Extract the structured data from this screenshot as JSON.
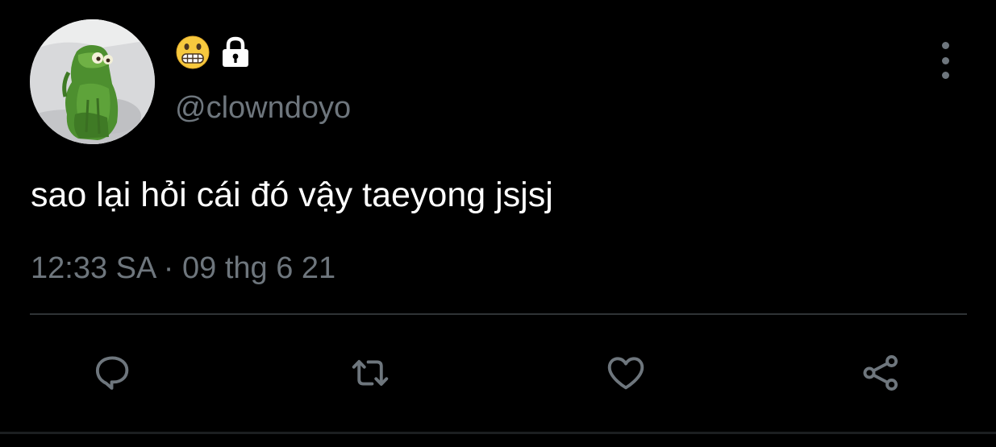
{
  "tweet": {
    "author": {
      "name_icons": [
        "grimacing-face-emoji",
        "lock-icon"
      ],
      "handle": "@clowndoyo",
      "avatar_icon": "kermit-frog-avatar"
    },
    "text": "sao lại hỏi cái đó vậy taeyong jsjsj",
    "timestamp": "12:33 SA · 09 thg 6 21",
    "more_menu_icon": "vertical-ellipsis-icon",
    "actions": [
      {
        "name": "reply",
        "icon": "speech-bubble-icon"
      },
      {
        "name": "retweet",
        "icon": "retweet-arrows-icon"
      },
      {
        "name": "like",
        "icon": "heart-icon"
      },
      {
        "name": "share",
        "icon": "share-nodes-icon"
      }
    ]
  },
  "colors": {
    "background": "#000000",
    "text_primary": "#ffffff",
    "text_secondary": "#6e767d",
    "divider": "#2f3336"
  }
}
